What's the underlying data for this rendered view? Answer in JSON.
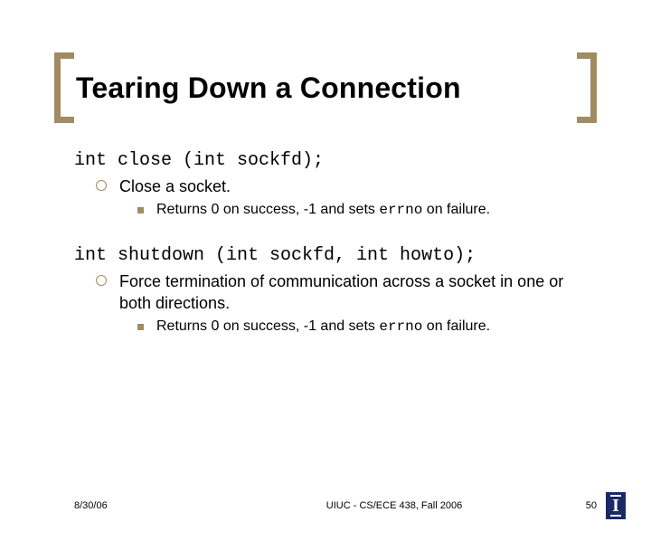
{
  "title": "Tearing Down a Connection",
  "code1": "int close (int sockfd);",
  "item1": "Close a socket.",
  "sub1_a": "Returns 0 on success, -1 and sets ",
  "sub1_code": "errno",
  "sub1_b": " on failure.",
  "code2": "int shutdown (int sockfd, int howto);",
  "item2": "Force termination of communication across a socket in one or both directions.",
  "sub2_a": "Returns 0 on success, -1 and sets ",
  "sub2_code": "errno",
  "sub2_b": " on failure.",
  "footer": {
    "date": "8/30/06",
    "center": "UIUC - CS/ECE 438, Fall 2006",
    "page": "50"
  },
  "logo_letter": "I"
}
